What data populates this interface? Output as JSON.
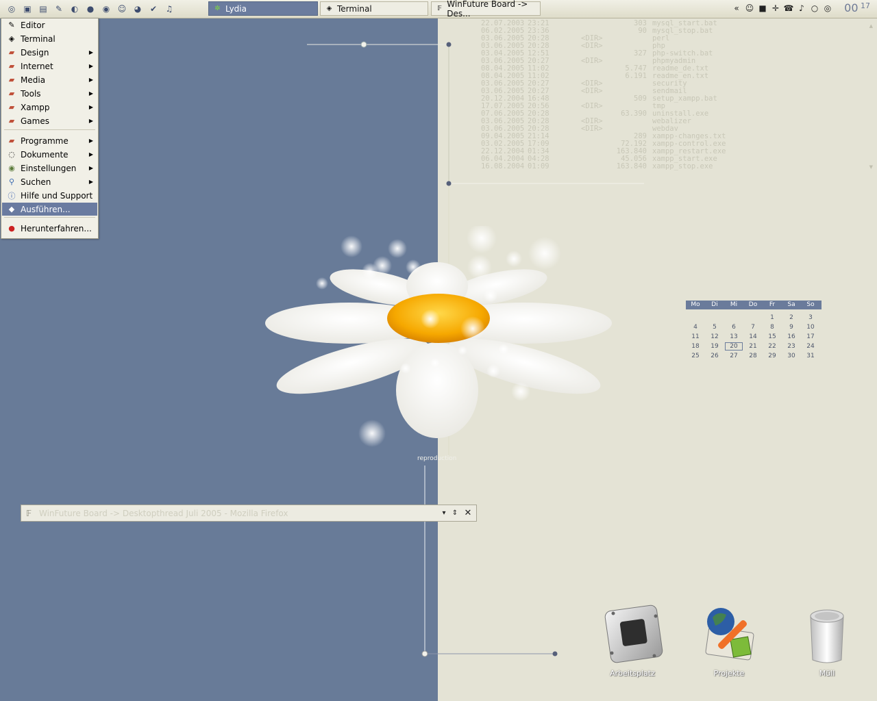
{
  "taskbar": {
    "quicklaunch": [
      "start-icon",
      "scheduler-icon",
      "notes-icon",
      "pen-icon",
      "gimp-icon",
      "globe-icon",
      "network-icon",
      "smiley-icon",
      "firefox-icon",
      "check-icon",
      "music-icon"
    ],
    "tasks": [
      {
        "label": "Lydia",
        "icon": "lydia-icon",
        "active": true
      },
      {
        "label": "Terminal",
        "icon": "terminal-icon",
        "active": false
      },
      {
        "label": "WinFuture Board -> Des...",
        "icon": "firefox-icon",
        "active": false
      }
    ],
    "tray": [
      "«",
      "☺",
      "■",
      "✛",
      "☎",
      "♪",
      "○",
      "◎"
    ],
    "clock": {
      "hour": "00",
      "minute": "17"
    }
  },
  "start_menu": {
    "items": [
      {
        "label": "Editor",
        "icon": "editor-icon",
        "submenu": false
      },
      {
        "label": "Terminal",
        "icon": "terminal-icon",
        "submenu": false
      },
      {
        "label": "Design",
        "icon": "folder-icon",
        "submenu": true
      },
      {
        "label": "Internet",
        "icon": "folder-icon",
        "submenu": true
      },
      {
        "label": "Media",
        "icon": "folder-icon",
        "submenu": true
      },
      {
        "label": "Tools",
        "icon": "folder-icon",
        "submenu": true
      },
      {
        "label": "Xampp",
        "icon": "folder-icon",
        "submenu": true
      },
      {
        "label": "Games",
        "icon": "folder-icon",
        "submenu": true
      },
      {
        "label": "Programme",
        "icon": "folder-icon",
        "submenu": true
      },
      {
        "label": "Dokumente",
        "icon": "documents-icon",
        "submenu": true
      },
      {
        "label": "Einstellungen",
        "icon": "settings-icon",
        "submenu": true
      },
      {
        "label": "Suchen",
        "icon": "search-icon",
        "submenu": true
      },
      {
        "label": "Hilfe und Support",
        "icon": "help-icon",
        "submenu": false
      },
      {
        "label": "Ausführen...",
        "icon": "run-icon",
        "submenu": false,
        "selected": true
      },
      {
        "label": "Herunterfahren...",
        "icon": "shutdown-icon",
        "submenu": false
      }
    ]
  },
  "listing": [
    [
      "22.07.2003",
      "23:21",
      "",
      "303",
      "mysql_start.bat"
    ],
    [
      "06.02.2005",
      "23:36",
      "",
      "90",
      "mysql_stop.bat"
    ],
    [
      "03.06.2005",
      "20:28",
      "<DIR>",
      "",
      "perl"
    ],
    [
      "03.06.2005",
      "20:28",
      "<DIR>",
      "",
      "php"
    ],
    [
      "03.04.2005",
      "12:51",
      "",
      "327",
      "php-switch.bat"
    ],
    [
      "03.06.2005",
      "20:27",
      "<DIR>",
      "",
      "phpmyadmin"
    ],
    [
      "08.04.2005",
      "11:02",
      "",
      "5.747",
      "readme_de.txt"
    ],
    [
      "08.04.2005",
      "11:02",
      "",
      "6.191",
      "readme_en.txt"
    ],
    [
      "03.06.2005",
      "20:27",
      "<DIR>",
      "",
      "security"
    ],
    [
      "03.06.2005",
      "20:27",
      "<DIR>",
      "",
      "sendmail"
    ],
    [
      "20.12.2004",
      "16:48",
      "",
      "509",
      "setup_xampp.bat"
    ],
    [
      "17.07.2005",
      "20:56",
      "<DIR>",
      "",
      "tmp"
    ],
    [
      "07.06.2005",
      "20:28",
      "",
      "63.390",
      "uninstall.exe"
    ],
    [
      "03.06.2005",
      "20:28",
      "<DIR>",
      "",
      "webalizer"
    ],
    [
      "03.06.2005",
      "20:28",
      "<DIR>",
      "",
      "webdav"
    ],
    [
      "09.04.2005",
      "21:14",
      "",
      "289",
      "xampp-changes.txt"
    ],
    [
      "03.02.2005",
      "17:09",
      "",
      "72.192",
      "xampp-control.exe"
    ],
    [
      "22.12.2004",
      "01:34",
      "",
      "163.840",
      "xampp_restart.exe"
    ],
    [
      "06.04.2004",
      "04:28",
      "",
      "45.056",
      "xampp_start.exe"
    ],
    [
      "16.08.2004",
      "01:09",
      "",
      "163.840",
      "xampp_stop.exe"
    ]
  ],
  "calendar": {
    "days": [
      "Mo",
      "Di",
      "Mi",
      "Do",
      "Fr",
      "Sa",
      "So"
    ],
    "weeks": [
      [
        "",
        "",
        "",
        "",
        "1",
        "2",
        "3"
      ],
      [
        "4",
        "5",
        "6",
        "7",
        "8",
        "9",
        "10"
      ],
      [
        "11",
        "12",
        "13",
        "14",
        "15",
        "16",
        "17"
      ],
      [
        "18",
        "19",
        "20",
        "21",
        "22",
        "23",
        "24"
      ],
      [
        "25",
        "26",
        "27",
        "28",
        "29",
        "30",
        "31"
      ]
    ],
    "today": "20"
  },
  "desktop_icons": [
    {
      "label": "Arbeitsplatz",
      "icon": "computer-icon"
    },
    {
      "label": "Projekte",
      "icon": "projects-icon"
    },
    {
      "label": "Müll",
      "icon": "trash-icon"
    }
  ],
  "firefox_bar": {
    "title": "WinFuture Board -> Desktopthread Juli 2005 - Mozilla Firefox"
  },
  "overlay_label": "reproduction",
  "colors": {
    "accent": "#6a7ba0",
    "desktop_left": "#687b98",
    "desktop_right": "#e4e3d5",
    "flower_center": "#f6a800"
  }
}
